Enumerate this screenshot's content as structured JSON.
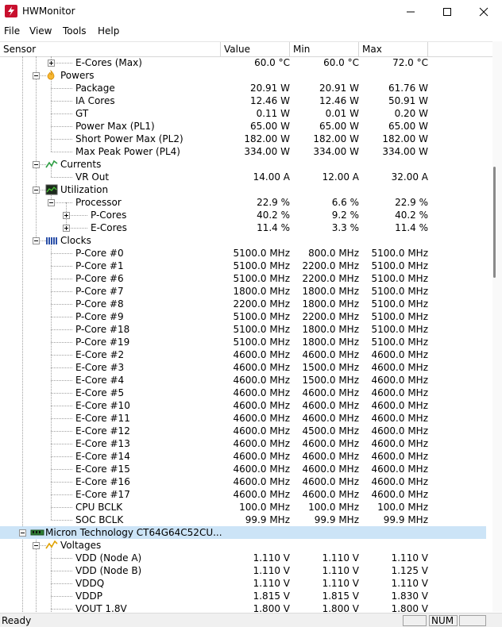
{
  "window": {
    "title": "HWMonitor",
    "app_icon": "hwmonitor-bolt-icon"
  },
  "menu": [
    "File",
    "View",
    "Tools",
    "Help"
  ],
  "columns": {
    "sensor": "Sensor",
    "value": "Value",
    "min": "Min",
    "max": "Max"
  },
  "status": {
    "text": "Ready",
    "num": "NUM"
  },
  "colors": {
    "selection": "#cce4f7",
    "app_icon": "#c8102e"
  },
  "rows": [
    {
      "level": 3,
      "exp": "plus",
      "label": "E-Cores (Max)",
      "value": "60.0 °C",
      "min": "60.0 °C",
      "max": "72.0 °C"
    },
    {
      "level": 2,
      "exp": "minus",
      "icon": "power-icon",
      "label": "Powers"
    },
    {
      "level": 3,
      "label": "Package",
      "value": "20.91 W",
      "min": "20.91 W",
      "max": "61.76 W"
    },
    {
      "level": 3,
      "label": "IA Cores",
      "value": "12.46 W",
      "min": "12.46 W",
      "max": "50.91 W"
    },
    {
      "level": 3,
      "label": "GT",
      "value": "0.11 W",
      "min": "0.01 W",
      "max": "0.20 W"
    },
    {
      "level": 3,
      "label": "Power Max (PL1)",
      "value": "65.00 W",
      "min": "65.00 W",
      "max": "65.00 W"
    },
    {
      "level": 3,
      "label": "Short Power Max (PL2)",
      "value": "182.00 W",
      "min": "182.00 W",
      "max": "182.00 W"
    },
    {
      "level": 3,
      "label": "Max Peak Power (PL4)",
      "value": "334.00 W",
      "min": "334.00 W",
      "max": "334.00 W"
    },
    {
      "level": 2,
      "exp": "minus",
      "icon": "currents-icon",
      "label": "Currents"
    },
    {
      "level": 3,
      "label": "VR Out",
      "value": "14.00 A",
      "min": "12.00 A",
      "max": "32.00 A"
    },
    {
      "level": 2,
      "exp": "minus",
      "icon": "utilization-icon",
      "label": "Utilization"
    },
    {
      "level": 3,
      "exp": "minus",
      "label": "Processor",
      "value": "22.9 %",
      "min": "6.6 %",
      "max": "22.9 %"
    },
    {
      "level": 4,
      "exp": "plus",
      "label": "P-Cores",
      "value": "40.2 %",
      "min": "9.2 %",
      "max": "40.2 %"
    },
    {
      "level": 4,
      "exp": "plus",
      "label": "E-Cores",
      "value": "11.4 %",
      "min": "3.3 %",
      "max": "11.4 %"
    },
    {
      "level": 2,
      "exp": "minus",
      "icon": "clocks-icon",
      "label": "Clocks"
    },
    {
      "level": 3,
      "label": "P-Core #0",
      "value": "5100.0 MHz",
      "min": "800.0 MHz",
      "max": "5100.0 MHz"
    },
    {
      "level": 3,
      "label": "P-Core #1",
      "value": "5100.0 MHz",
      "min": "2200.0 MHz",
      "max": "5100.0 MHz"
    },
    {
      "level": 3,
      "label": "P-Core #6",
      "value": "5100.0 MHz",
      "min": "2200.0 MHz",
      "max": "5100.0 MHz"
    },
    {
      "level": 3,
      "label": "P-Core #7",
      "value": "1800.0 MHz",
      "min": "1800.0 MHz",
      "max": "5100.0 MHz"
    },
    {
      "level": 3,
      "label": "P-Core #8",
      "value": "2200.0 MHz",
      "min": "1800.0 MHz",
      "max": "5100.0 MHz"
    },
    {
      "level": 3,
      "label": "P-Core #9",
      "value": "5100.0 MHz",
      "min": "2200.0 MHz",
      "max": "5100.0 MHz"
    },
    {
      "level": 3,
      "label": "P-Core #18",
      "value": "5100.0 MHz",
      "min": "1800.0 MHz",
      "max": "5100.0 MHz"
    },
    {
      "level": 3,
      "label": "P-Core #19",
      "value": "5100.0 MHz",
      "min": "1800.0 MHz",
      "max": "5100.0 MHz"
    },
    {
      "level": 3,
      "label": "E-Core #2",
      "value": "4600.0 MHz",
      "min": "4600.0 MHz",
      "max": "4600.0 MHz"
    },
    {
      "level": 3,
      "label": "E-Core #3",
      "value": "4600.0 MHz",
      "min": "1500.0 MHz",
      "max": "4600.0 MHz"
    },
    {
      "level": 3,
      "label": "E-Core #4",
      "value": "4600.0 MHz",
      "min": "1500.0 MHz",
      "max": "4600.0 MHz"
    },
    {
      "level": 3,
      "label": "E-Core #5",
      "value": "4600.0 MHz",
      "min": "4600.0 MHz",
      "max": "4600.0 MHz"
    },
    {
      "level": 3,
      "label": "E-Core #10",
      "value": "4600.0 MHz",
      "min": "4600.0 MHz",
      "max": "4600.0 MHz"
    },
    {
      "level": 3,
      "label": "E-Core #11",
      "value": "4600.0 MHz",
      "min": "4600.0 MHz",
      "max": "4600.0 MHz"
    },
    {
      "level": 3,
      "label": "E-Core #12",
      "value": "4600.0 MHz",
      "min": "4500.0 MHz",
      "max": "4600.0 MHz"
    },
    {
      "level": 3,
      "label": "E-Core #13",
      "value": "4600.0 MHz",
      "min": "4600.0 MHz",
      "max": "4600.0 MHz"
    },
    {
      "level": 3,
      "label": "E-Core #14",
      "value": "4600.0 MHz",
      "min": "4600.0 MHz",
      "max": "4600.0 MHz"
    },
    {
      "level": 3,
      "label": "E-Core #15",
      "value": "4600.0 MHz",
      "min": "4600.0 MHz",
      "max": "4600.0 MHz"
    },
    {
      "level": 3,
      "label": "E-Core #16",
      "value": "4600.0 MHz",
      "min": "4600.0 MHz",
      "max": "4600.0 MHz"
    },
    {
      "level": 3,
      "label": "E-Core #17",
      "value": "4600.0 MHz",
      "min": "4600.0 MHz",
      "max": "4600.0 MHz"
    },
    {
      "level": 3,
      "label": "CPU BCLK",
      "value": "100.0 MHz",
      "min": "100.0 MHz",
      "max": "100.0 MHz"
    },
    {
      "level": 3,
      "label": "SOC BCLK",
      "value": "99.9 MHz",
      "min": "99.9 MHz",
      "max": "99.9 MHz"
    },
    {
      "level": 1,
      "exp": "minus",
      "icon": "memory-module-icon",
      "label": "Micron Technology CT64G64C52CU...",
      "selected": true
    },
    {
      "level": 2,
      "exp": "minus",
      "icon": "voltage-icon",
      "label": "Voltages"
    },
    {
      "level": 3,
      "label": "VDD (Node A)",
      "value": "1.110 V",
      "min": "1.110 V",
      "max": "1.110 V"
    },
    {
      "level": 3,
      "label": "VDD (Node B)",
      "value": "1.110 V",
      "min": "1.110 V",
      "max": "1.125 V"
    },
    {
      "level": 3,
      "label": "VDDQ",
      "value": "1.110 V",
      "min": "1.110 V",
      "max": "1.110 V"
    },
    {
      "level": 3,
      "label": "VDDP",
      "value": "1.815 V",
      "min": "1.815 V",
      "max": "1.830 V"
    },
    {
      "level": 3,
      "label": "VOUT 1.8V",
      "value": "1.800 V",
      "min": "1.800 V",
      "max": "1.800 V"
    }
  ]
}
